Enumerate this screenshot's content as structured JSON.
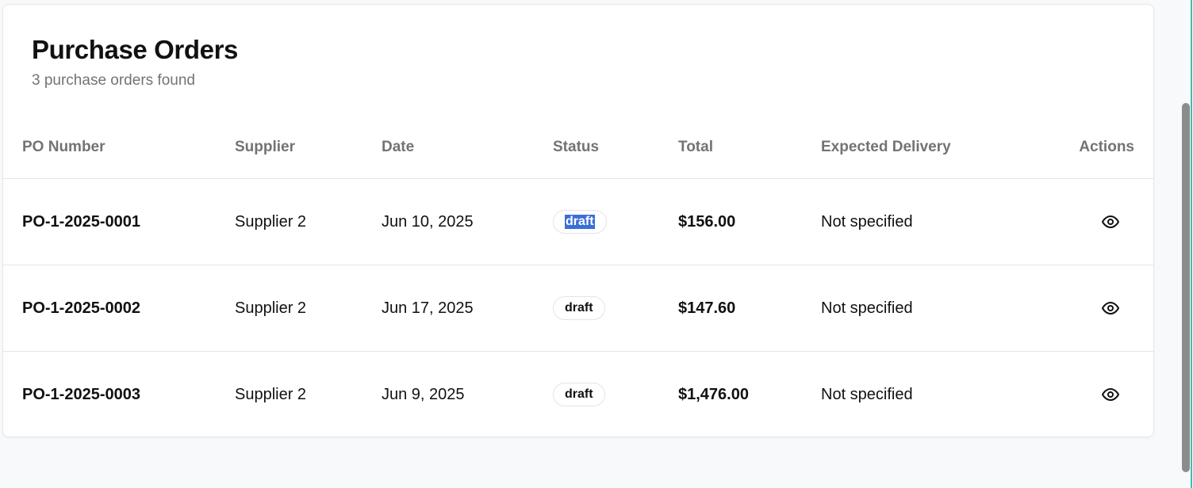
{
  "header": {
    "title": "Purchase Orders",
    "subtitle": "3 purchase orders found"
  },
  "table": {
    "columns": {
      "po_number": "PO Number",
      "supplier": "Supplier",
      "date": "Date",
      "status": "Status",
      "total": "Total",
      "expected_delivery": "Expected Delivery",
      "actions": "Actions"
    },
    "rows": [
      {
        "po_number": "PO-1-2025-0001",
        "supplier": "Supplier 2",
        "date": "Jun 10, 2025",
        "status": "draft",
        "total": "$156.00",
        "expected_delivery": "Not specified",
        "action_icon": "eye-icon"
      },
      {
        "po_number": "PO-1-2025-0002",
        "supplier": "Supplier 2",
        "date": "Jun 17, 2025",
        "status": "draft",
        "total": "$147.60",
        "expected_delivery": "Not specified",
        "action_icon": "eye-icon"
      },
      {
        "po_number": "PO-1-2025-0003",
        "supplier": "Supplier 2",
        "date": "Jun 9, 2025",
        "status": "draft",
        "total": "$1,476.00",
        "expected_delivery": "Not specified",
        "action_icon": "eye-icon"
      }
    ]
  },
  "colors": {
    "selection_highlight": "#3b6fd4",
    "muted_text": "#737373",
    "border": "#e4e4e7",
    "window_edge": "#3bbfb0"
  }
}
